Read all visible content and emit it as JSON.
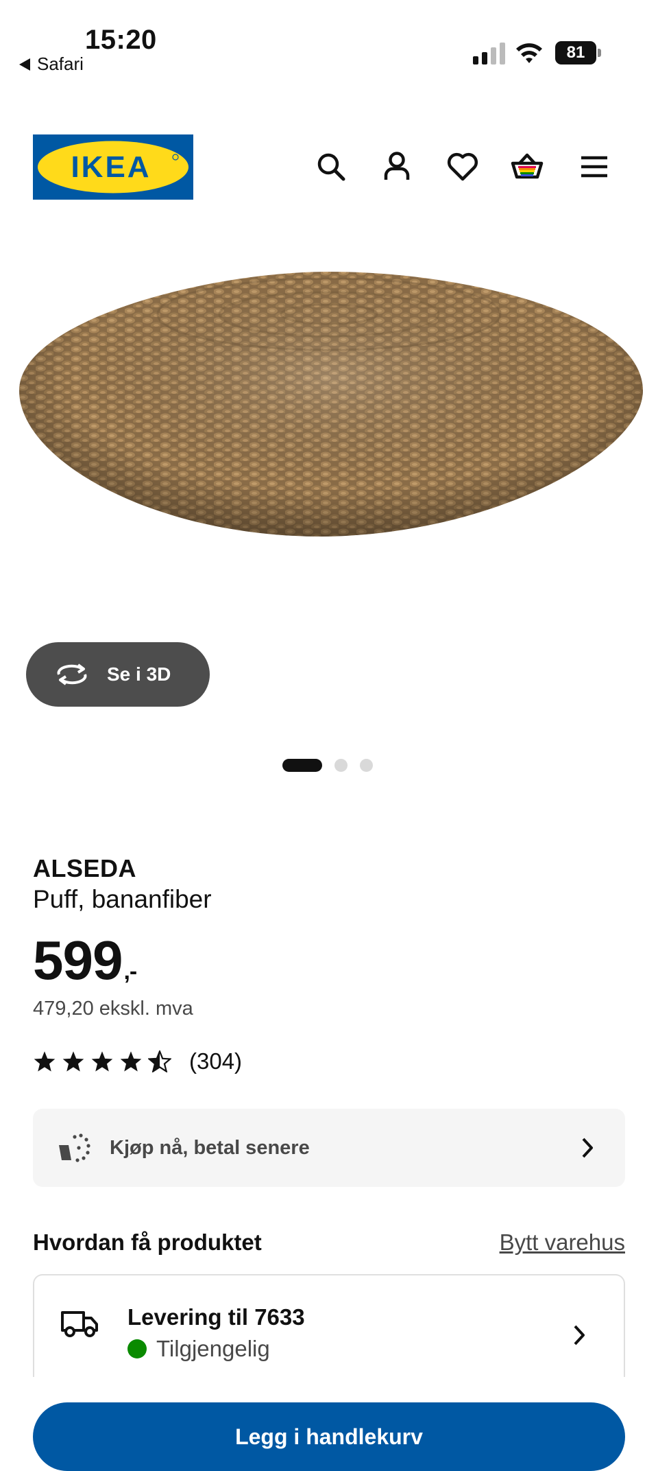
{
  "status_bar": {
    "time": "15:20",
    "back_app": "Safari",
    "battery": "81"
  },
  "header": {
    "logo_text": "IKEA",
    "icons": [
      "search-icon",
      "account-icon",
      "heart-icon",
      "basket-icon",
      "menu-icon"
    ]
  },
  "gallery": {
    "view_3d_label": "Se i 3D",
    "current_slide": 1,
    "slide_count": 3
  },
  "product": {
    "name": "ALSEDA",
    "description": "Puff, bananfiber",
    "price": "599",
    "price_suffix": ",-",
    "price_ex_vat": "479,20 ekskl. mva",
    "rating_stars": 4.5,
    "rating_max": 5,
    "review_count": "(304)"
  },
  "pay_later": {
    "label": "Kjøp nå, betal senere"
  },
  "fulfilment": {
    "heading": "Hvordan få produktet",
    "change_store": "Bytt varehus",
    "delivery_title": "Levering til 7633",
    "delivery_status": "Tilgjengelig"
  },
  "cta": {
    "add_to_cart": "Legg i handlekurv"
  },
  "colors": {
    "ikea_blue": "#0058a3",
    "ikea_yellow": "#ffda1a",
    "available_green": "#0a8a00",
    "button_dark": "#4d4d4d"
  }
}
